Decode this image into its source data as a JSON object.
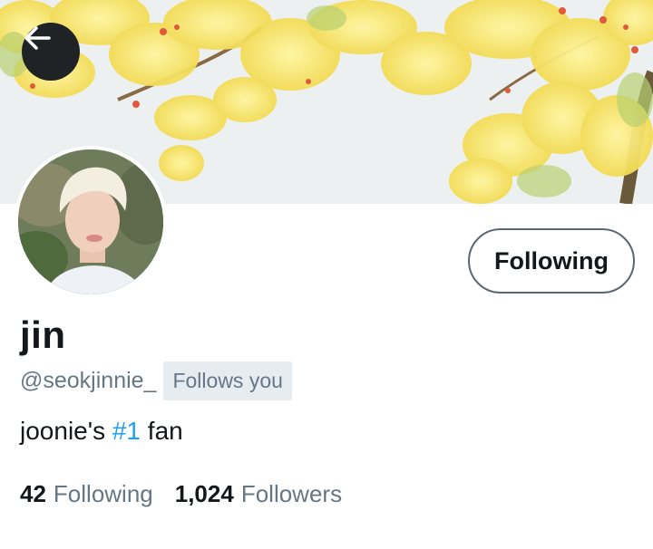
{
  "header": {
    "back_icon": "arrow-left-icon"
  },
  "profile": {
    "display_name": "jin",
    "handle": "@seokjinnie_",
    "follows_you_badge": "Follows you",
    "bio_prefix": "joonie's ",
    "bio_hashtag": "#1",
    "bio_suffix": " fan",
    "follow_button_label": "Following"
  },
  "stats": {
    "following_count": "42",
    "following_label": "Following",
    "followers_count": "1,024",
    "followers_label": "Followers"
  },
  "colors": {
    "link": "#1da1f2",
    "secondary_text": "#657786",
    "badge_bg": "#e6ecf0"
  }
}
